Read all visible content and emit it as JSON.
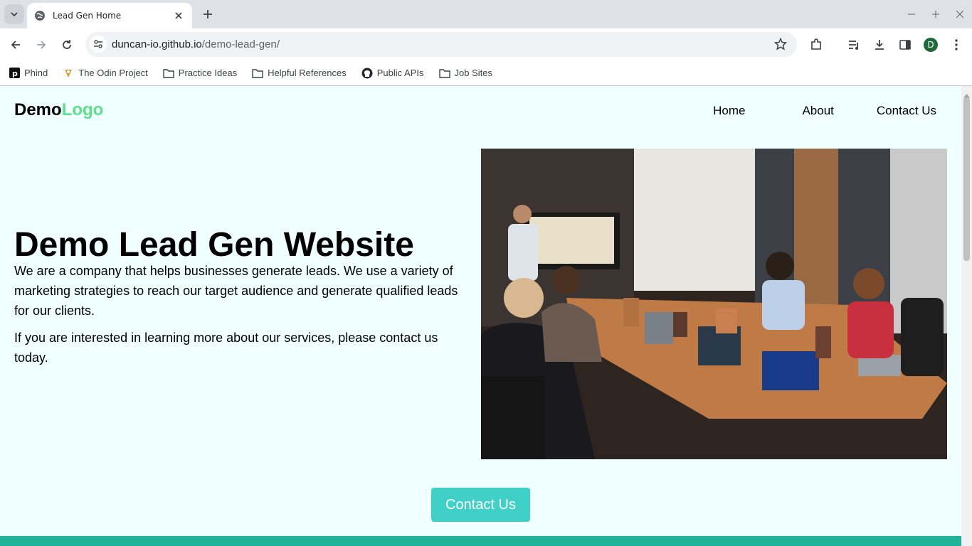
{
  "browser": {
    "tab_title": "Lead Gen Home",
    "url_host": "duncan-io.github.io",
    "url_path": "/demo-lead-gen/",
    "profile_initial": "D",
    "bookmarks": [
      {
        "label": "Phind",
        "icon": "phind-icon"
      },
      {
        "label": "The Odin Project",
        "icon": "odin-icon"
      },
      {
        "label": "Practice Ideas",
        "icon": "folder-icon"
      },
      {
        "label": "Helpful References",
        "icon": "folder-icon"
      },
      {
        "label": "Public APIs",
        "icon": "github-icon"
      },
      {
        "label": "Job Sites",
        "icon": "folder-icon"
      }
    ]
  },
  "page": {
    "logo_part1": "Demo",
    "logo_part2": "Logo",
    "logo_accent_color": "#5ce08a",
    "nav": [
      "Home",
      "About",
      "Contact Us"
    ],
    "hero_title": "Demo Lead Gen Website",
    "hero_p1": "We are a company that helps businesses generate leads. We use a variety of marketing strategies to reach our target audience and generate qualified leads for our clients.",
    "hero_p2": "If you are interested in learning more about our services, please contact us today.",
    "cta_label": "Contact Us",
    "cta_color": "#40d0c8",
    "footer_color": "#20b39a",
    "background_color": "#f0ffff"
  }
}
